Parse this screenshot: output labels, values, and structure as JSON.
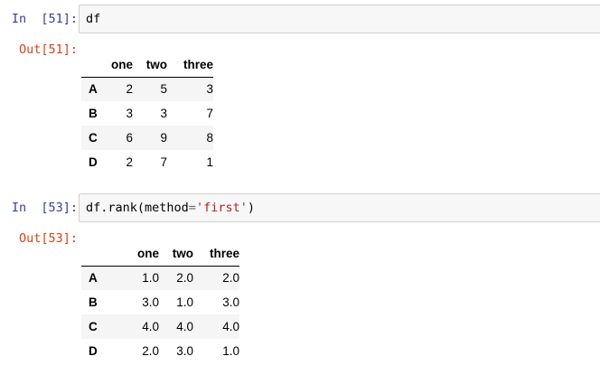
{
  "cells": [
    {
      "in_prompt": "In  [51]:",
      "code": "df",
      "out_prompt": "Out[51]:",
      "columns": [
        "one",
        "two",
        "three"
      ],
      "rows": [
        {
          "index": "A",
          "values": [
            "2",
            "5",
            "3"
          ]
        },
        {
          "index": "B",
          "values": [
            "3",
            "3",
            "7"
          ]
        },
        {
          "index": "C",
          "values": [
            "6",
            "9",
            "8"
          ]
        },
        {
          "index": "D",
          "values": [
            "2",
            "7",
            "1"
          ]
        }
      ]
    },
    {
      "in_prompt": "In  [53]:",
      "code_tokens": {
        "prefix": "df.rank(method",
        "op": "=",
        "string": "'first'",
        "suffix": ")"
      },
      "out_prompt": "Out[53]:",
      "columns": [
        "one",
        "two",
        "three"
      ],
      "rows": [
        {
          "index": "A",
          "values": [
            "1.0",
            "2.0",
            "2.0"
          ]
        },
        {
          "index": "B",
          "values": [
            "3.0",
            "1.0",
            "3.0"
          ]
        },
        {
          "index": "C",
          "values": [
            "4.0",
            "4.0",
            "4.0"
          ]
        },
        {
          "index": "D",
          "values": [
            "2.0",
            "3.0",
            "1.0"
          ]
        }
      ]
    }
  ],
  "colors": {
    "in_prompt": "#303f9f",
    "out_prompt": "#d84315",
    "string": "#ba2121",
    "input_background": "#f7f7f7"
  }
}
